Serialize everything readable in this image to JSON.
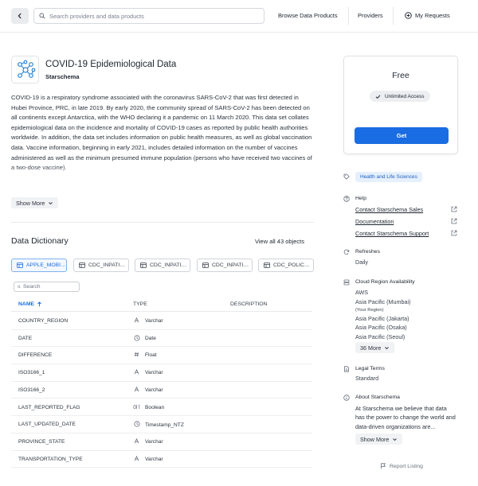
{
  "nav": {
    "search_placeholder": "Search providers and data products",
    "browse_label": "Browse Data Products",
    "providers_label": "Providers",
    "requests_label": "My Requests"
  },
  "listing": {
    "title": "COVID-19 Epidemiological Data",
    "provider": "Starschema",
    "description": "COVID-19 is a respiratory syndrome associated with the coronavirus SARS-CoV-2 that was first detected in Hubei Province, PRC, in late 2019. By early 2020, the community spread of SARS-CoV-2 has been detected on all continents except Antarctica, with the WHO declaring it a pandemic on 11 March 2020. This data set collates epidemiological data on the incidence and mortality of COVID-19 cases as reported by public health authorities worldwide. In addition, the data set includes information on public health measures, as well as global vaccination data. Vaccine information, beginning in early 2021, includes detailed information on the number of vaccines administered as well as the minimum presumed immune population (persons who have received two vaccines of a two-dose vaccine).",
    "show_more": "Show More"
  },
  "dictionary": {
    "title": "Data Dictionary",
    "view_all": "View all 43 objects",
    "tabs": [
      {
        "label": "APPLE_MOBILITY",
        "active": true
      },
      {
        "label": "CDC_INPATIENT_BEDS_ALL",
        "active": false
      },
      {
        "label": "CDC_INPATIENT_BEDS_COVID",
        "active": false
      },
      {
        "label": "CDC_INPATIENT_BEDS_ICU",
        "active": false
      },
      {
        "label": "CDC_POLICY_MEASURES",
        "active": false
      }
    ],
    "search_placeholder": "Search",
    "columns": {
      "name": "NAME",
      "type": "TYPE",
      "description": "DESCRIPTION"
    },
    "rows": [
      {
        "name": "COUNTRY_REGION",
        "type": "Varchar",
        "icon": "A"
      },
      {
        "name": "DATE",
        "type": "Date",
        "icon": "clock"
      },
      {
        "name": "DIFFERENCE",
        "type": "Float",
        "icon": "#"
      },
      {
        "name": "ISO3166_1",
        "type": "Varchar",
        "icon": "A"
      },
      {
        "name": "ISO3166_2",
        "type": "Varchar",
        "icon": "A"
      },
      {
        "name": "LAST_REPORTED_FLAG",
        "type": "Boolean",
        "icon": "0|1"
      },
      {
        "name": "LAST_UPDATED_DATE",
        "type": "Timestamp_NTZ",
        "icon": "clock"
      },
      {
        "name": "PROVINCE_STATE",
        "type": "Varchar",
        "icon": "A"
      },
      {
        "name": "TRANSPORTATION_TYPE",
        "type": "Varchar",
        "icon": "A"
      }
    ]
  },
  "sidebar": {
    "price": "Free",
    "access": "Unlimited Access",
    "get_label": "Get",
    "category": "Health and Life Sciences",
    "help_label": "Help",
    "help_links": [
      "Contact Starschema Sales",
      "Documentation",
      "Contact Starschema Support"
    ],
    "refreshes_label": "Refreshes",
    "refreshes_value": "Daily",
    "region_label": "Cloud Region Availability",
    "region_cloud": "AWS",
    "regions": [
      "Asia Pacific (Mumbai)",
      "(Your Region)",
      "Asia Pacific (Jakarta)",
      "Asia Pacific (Osaka)",
      "Asia Pacific (Seoul)"
    ],
    "more_regions": "36 More",
    "legal_label": "Legal Terms",
    "legal_value": "Standard",
    "about_label": "About Starschema",
    "about_text": "At Starschema we believe that data has the power to change the world and data-driven organizations are...",
    "about_more": "Show More",
    "report": "Report Listing"
  },
  "colors": {
    "accent": "#1a6ce2",
    "tag_bg": "#e6f0fd"
  }
}
